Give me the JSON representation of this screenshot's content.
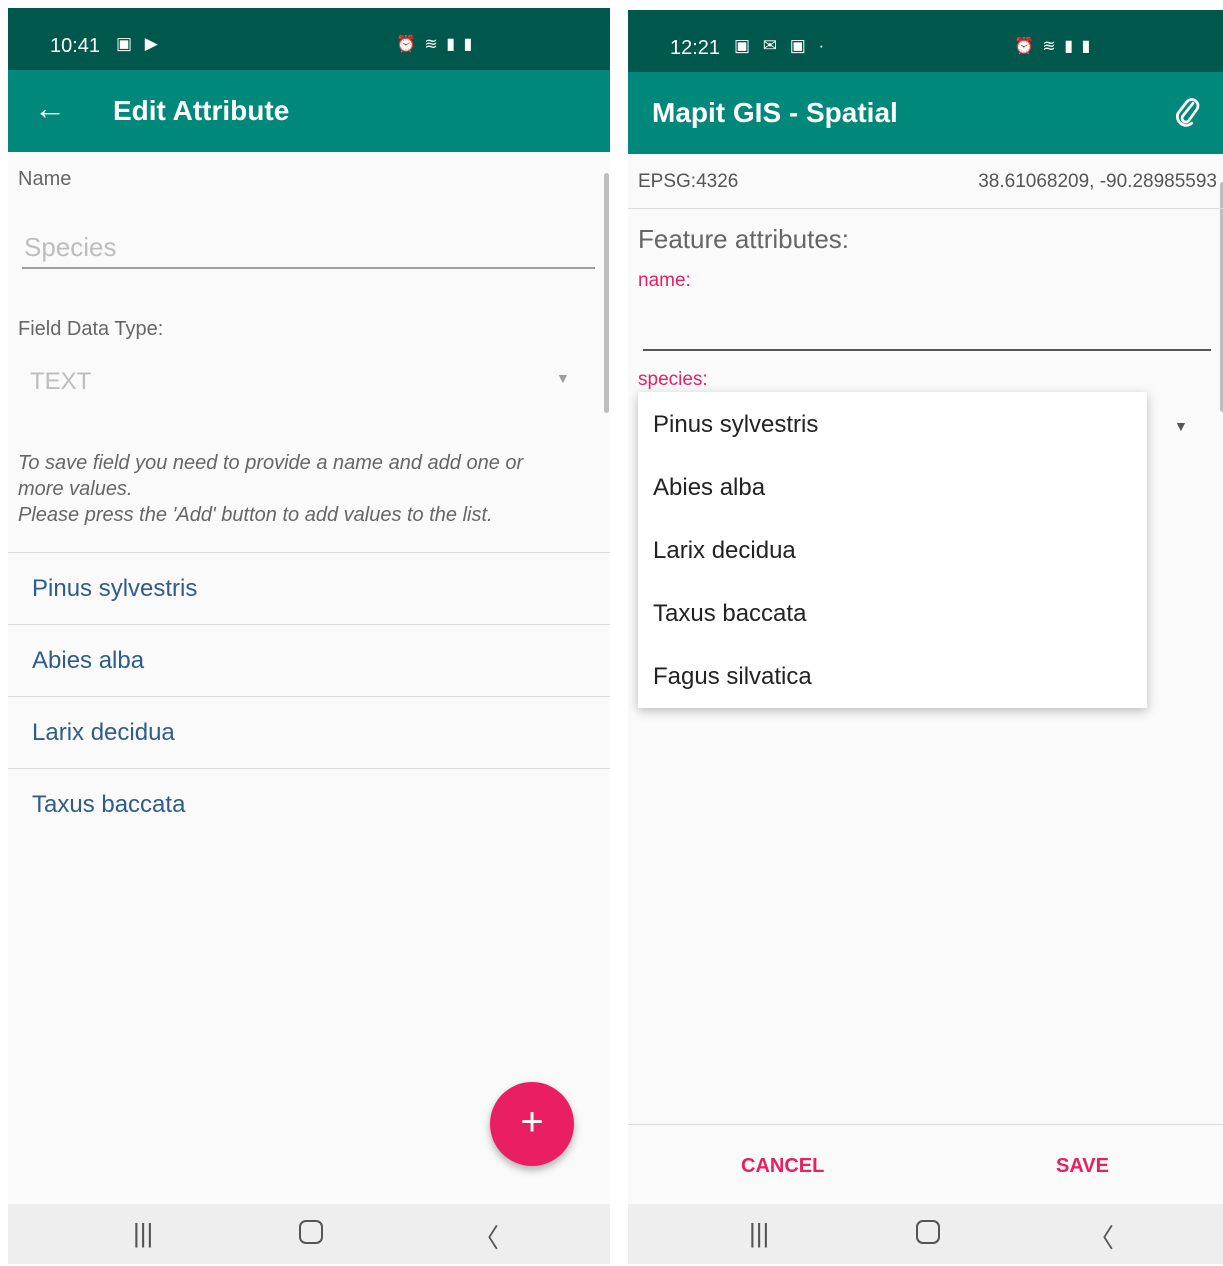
{
  "left": {
    "status": {
      "time": "10:41"
    },
    "appbar": {
      "title": "Edit Attribute"
    },
    "name_label": "Name",
    "name_placeholder": "Species",
    "type_label": "Field Data Type:",
    "type_value": "TEXT",
    "help_lines": [
      "To save field you need to provide a name and add one or",
      "more values.",
      "Please press the 'Add' button to add values to the list."
    ],
    "values": [
      "Pinus sylvestris",
      "Abies alba",
      "Larix decidua",
      "Taxus baccata"
    ],
    "fab_label": "+"
  },
  "right": {
    "status": {
      "time": "12:21"
    },
    "appbar": {
      "title": "Mapit GIS - Spatial"
    },
    "crs": "EPSG:4326",
    "coords": "38.61068209, -90.28985593",
    "section_title": "Feature attributes:",
    "name_label": "name:",
    "species_label": "species:",
    "dropdown_options": [
      "Pinus sylvestris",
      "Abies alba",
      "Larix decidua",
      "Taxus baccata",
      "Fagus silvatica"
    ],
    "cancel": "CANCEL",
    "save": "SAVE"
  },
  "colors": {
    "appbar": "#00897b",
    "statusbar": "#00574b",
    "accent": "#e91e63",
    "link": "#2f5c8a"
  },
  "icons": [
    "back-arrow-icon",
    "dropdown-arrow-icon",
    "paperclip-icon",
    "add-icon",
    "recents-icon",
    "home-icon",
    "back-nav-icon"
  ]
}
